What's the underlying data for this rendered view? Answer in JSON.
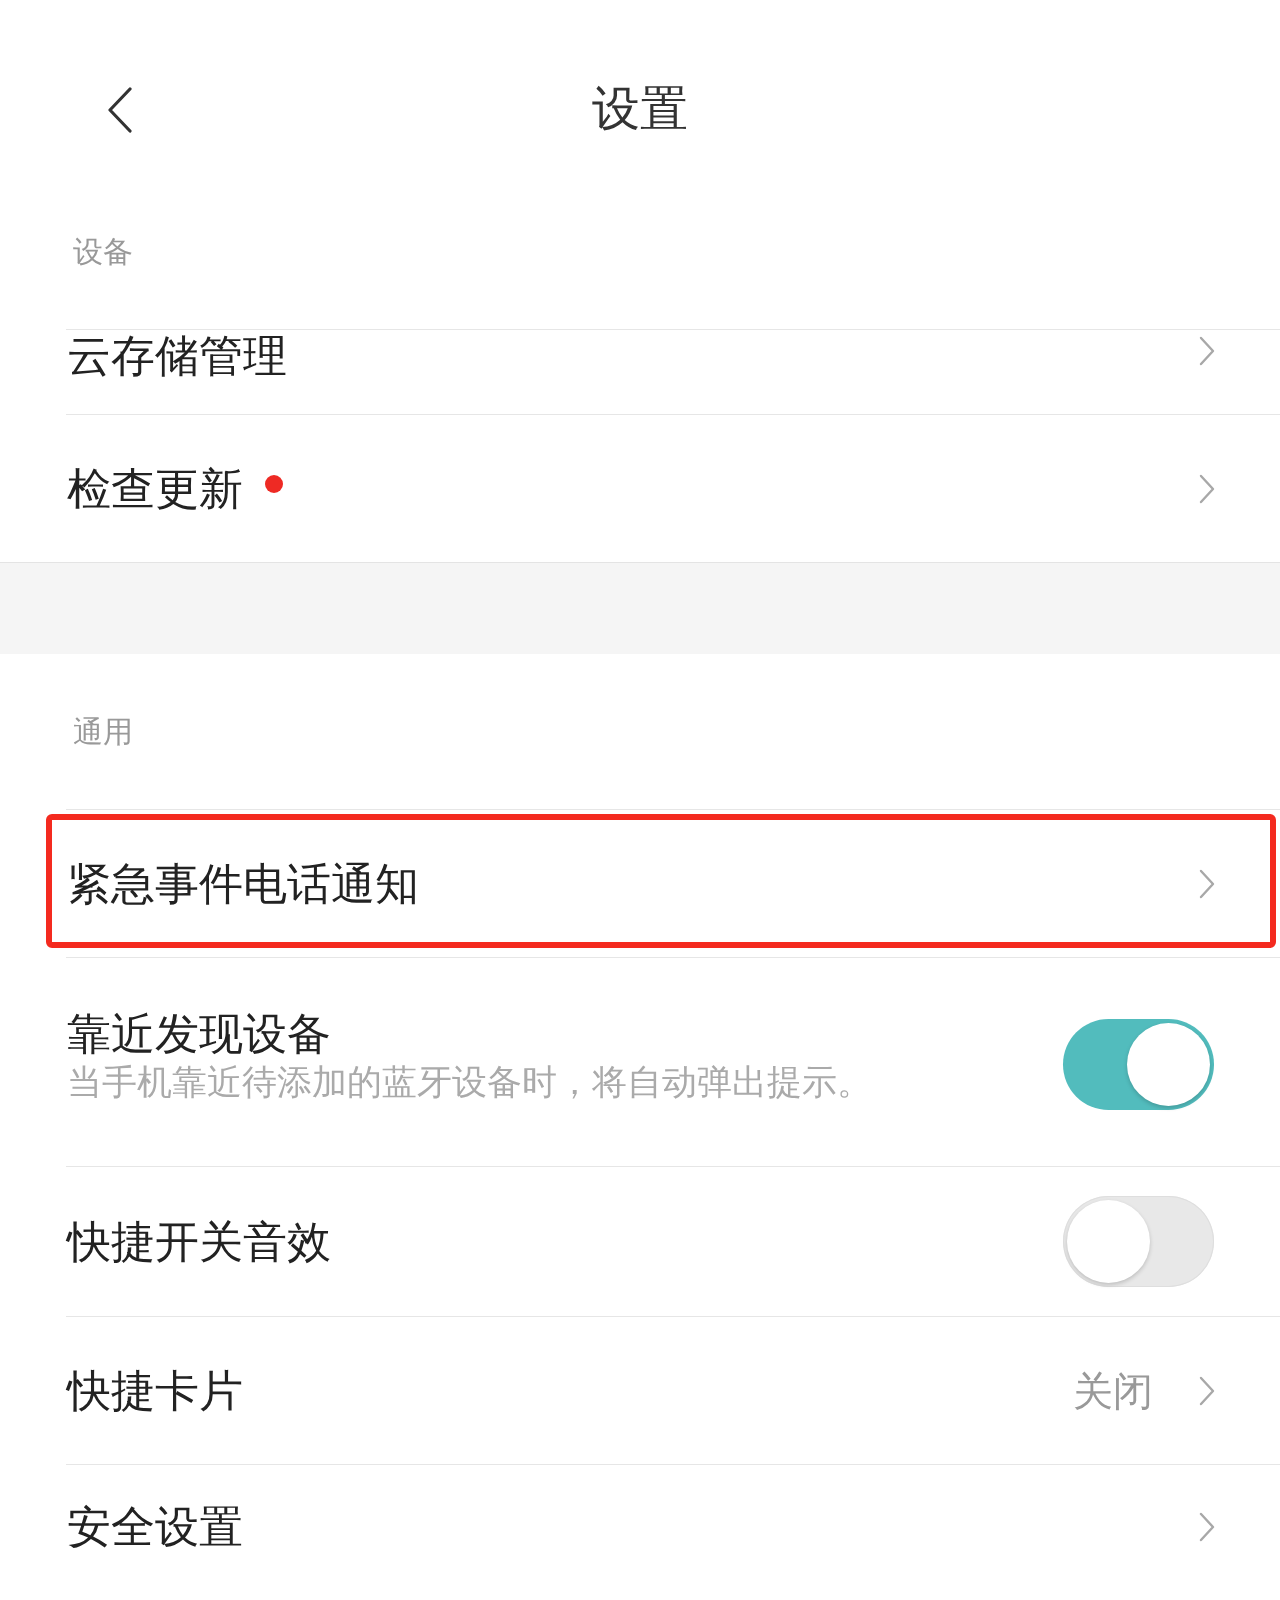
{
  "header": {
    "title": "设置"
  },
  "sections": [
    {
      "label": "设备",
      "items": [
        {
          "kind": "link",
          "title": "云存储管理",
          "dot": false,
          "highlighted": false
        },
        {
          "kind": "link",
          "title": "检查更新",
          "dot": true,
          "highlighted": false
        }
      ]
    },
    {
      "label": "通用",
      "items": [
        {
          "kind": "link",
          "title": "紧急事件电话通知",
          "dot": false,
          "highlighted": true
        },
        {
          "kind": "toggle",
          "title": "靠近发现设备",
          "description": "当手机靠近待添加的蓝牙设备时，将自动弹出提示。",
          "on": true,
          "dot": false,
          "highlighted": false
        },
        {
          "kind": "toggle",
          "title": "快捷开关音效",
          "on": false,
          "dot": false,
          "highlighted": false
        },
        {
          "kind": "link",
          "title": "快捷卡片",
          "value": "关闭",
          "dot": false,
          "highlighted": false
        },
        {
          "kind": "link",
          "title": "安全设置",
          "dot": false,
          "highlighted": false
        }
      ]
    }
  ]
}
